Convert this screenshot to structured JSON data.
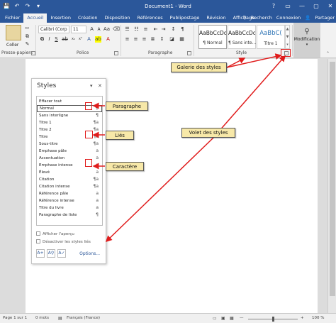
{
  "window": {
    "title": "Document1 - Word",
    "controls": [
      "?",
      "▭",
      "—",
      "▢",
      "✕"
    ]
  },
  "quick_access": [
    "💾",
    "↶",
    "↷",
    "▾"
  ],
  "tabs": [
    "Fichier",
    "Accueil",
    "Insertion",
    "Création",
    "Disposition",
    "Références",
    "Publipostage",
    "Révision",
    "Affichage"
  ],
  "tabs_active": "Accueil",
  "tabbar_right": {
    "search": "Recherch",
    "login": "Connexion",
    "share": "Partager"
  },
  "ribbon": {
    "clipboard": {
      "paste_label": "Coller",
      "group_label": "Presse-papiers"
    },
    "font": {
      "name": "Calibri (Corp",
      "size": "11",
      "group_label": "Police"
    },
    "paragraph": {
      "group_label": "Paragraphe"
    },
    "style": {
      "group_label": "Style",
      "cards": [
        {
          "preview": "AaBbCcDc",
          "name": "¶ Normal"
        },
        {
          "preview": "AaBbCcDc",
          "name": "¶ Sans inte..."
        },
        {
          "preview": "AaBbC(",
          "name": "Titre 1"
        }
      ]
    },
    "editing": {
      "label": "Modification"
    }
  },
  "styles_pane": {
    "title": "Styles",
    "items": [
      {
        "label": "Effacer tout",
        "icon": ""
      },
      {
        "label": "Normal",
        "icon": "¶"
      },
      {
        "label": "Sans interligne",
        "icon": "¶"
      },
      {
        "label": "Titre 1",
        "icon": "¶a"
      },
      {
        "label": "Titre 2",
        "icon": "¶a"
      },
      {
        "label": "Titre",
        "icon": "¶a"
      },
      {
        "label": "Sous-titre",
        "icon": "¶a"
      },
      {
        "label": "Emphase pâle",
        "icon": "a"
      },
      {
        "label": "Accentuation",
        "icon": "a"
      },
      {
        "label": "Emphase intense",
        "icon": "a"
      },
      {
        "label": "Élevé",
        "icon": "a"
      },
      {
        "label": "Citation",
        "icon": "¶a"
      },
      {
        "label": "Citation intense",
        "icon": "¶a"
      },
      {
        "label": "Référence pâle",
        "icon": "a"
      },
      {
        "label": "Référence intense",
        "icon": "a"
      },
      {
        "label": "Titre du livre",
        "icon": "a"
      },
      {
        "label": "Paragraphe de liste",
        "icon": "¶"
      }
    ],
    "show_preview": "Afficher l'aperçu",
    "disable_linked": "Désactiver les styles liés",
    "options": "Options..."
  },
  "callouts": {
    "gallery": "Galerie des styles",
    "pane": "Volet des styles",
    "paragraph": "Paragraphe",
    "linked": "Liés",
    "character": "Caractère"
  },
  "statusbar": {
    "page": "Page 1 sur 1",
    "words": "0 mots",
    "language": "Français (France)",
    "zoom": "100 %"
  },
  "colors": {
    "word_blue": "#2b579a",
    "callout_bg": "#f7e8a8",
    "highlight": "#e01c1c"
  }
}
